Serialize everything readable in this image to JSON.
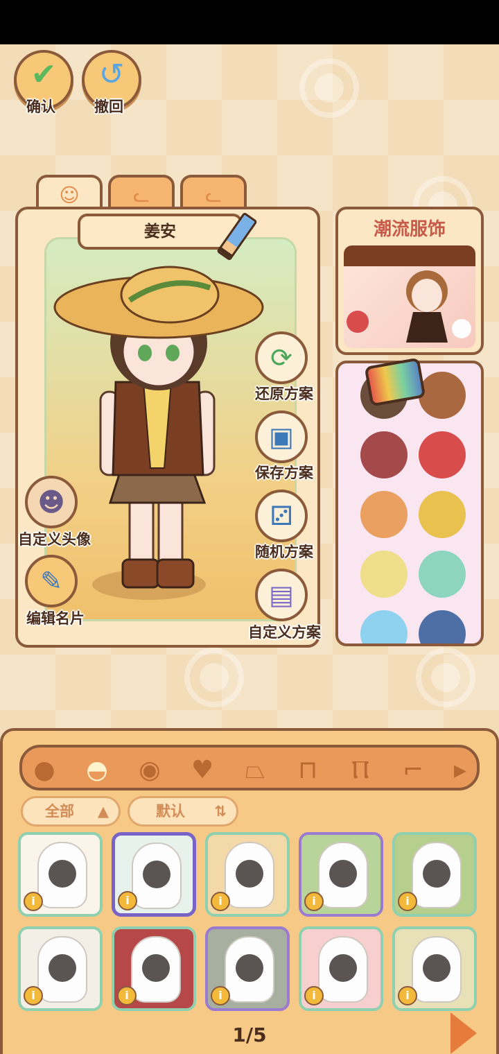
{
  "top": {
    "confirm_label": "确认",
    "undo_label": "撤回"
  },
  "character": {
    "name": "姜安"
  },
  "side_actions": {
    "custom_avatar": "自定义头像",
    "edit_card": "编辑名片"
  },
  "actions": {
    "restore": "还原方案",
    "save": "保存方案",
    "random": "随机方案",
    "custom": "自定义方案"
  },
  "fashion": {
    "title": "潮流服饰"
  },
  "palette": {
    "colors": [
      "#6b4d3c",
      "#a9683f",
      "#a54a4a",
      "#d94c4c",
      "#e9a060",
      "#e8c14f",
      "#efde8a",
      "#8dd6bd",
      "#8fd2f0",
      "#4e6fa6"
    ]
  },
  "filters": {
    "category": "全部",
    "sort": "默认"
  },
  "items": [
    {
      "info": "i"
    },
    {
      "info": "i"
    },
    {
      "info": "i"
    },
    {
      "info": "i"
    },
    {
      "info": "i"
    },
    {
      "info": "i"
    },
    {
      "info": "i"
    },
    {
      "info": "i"
    },
    {
      "info": "i"
    },
    {
      "info": "i"
    }
  ],
  "pagination": {
    "text": "1/5"
  }
}
